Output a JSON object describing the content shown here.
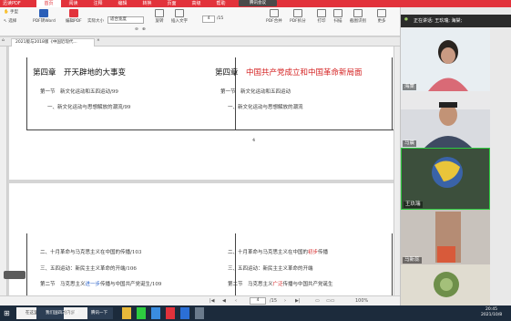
{
  "titlebar": {
    "app_name": "迅读PDF",
    "menus": [
      "首页",
      "阅读",
      "注释",
      "编辑",
      "转换",
      "页面",
      "高级",
      "帮助"
    ],
    "active_menu": "首页",
    "meeting_label": "腾讯会议"
  },
  "toolbar": {
    "hand": "手型",
    "select": "选择",
    "pdf_to_word": "PDF转Word",
    "edit_pdf": "编辑PDF",
    "actual_size": "实际大小",
    "zoom_value": "适合宽度",
    "rotate": "旋转",
    "insert_text": "插入文字",
    "page_current": "4",
    "page_total": "/15",
    "pdf_merge": "PDF合并",
    "pdf_split": "PDF拆分",
    "print": "打印",
    "ocr": "扫描",
    "screenshot": "截图识别",
    "more": "更多"
  },
  "tab": {
    "label": "2021版与2018版《中国近现代..."
  },
  "page1": {
    "left_chapter": "第四章　开天辟地的大事变",
    "left_section": "第一节　新文化运动和五四运动/99",
    "left_item": "一、新文化运动与思想解放的潮流/99",
    "right_chapter": "第四章",
    "right_chapter_red": "中国共产党成立和中国革命新局面",
    "right_section": "第一节　新文化运动和五四运动",
    "right_item": "一、新文化运动与思想解放的潮流",
    "page_number": "4"
  },
  "page2": {
    "left_rows": [
      "二、十月革命与马克思主义在中国的传播/103",
      "三、五四运动：新民主主义革命的开端/106",
      "第二节　马克思主义进一步传播与中国共产党诞生/109"
    ],
    "left_row3_pre": "第二节　马克思主义",
    "left_row3_blue": "进一步",
    "left_row3_post": "传播与中国共产党诞生/109",
    "right_row1_pre": "二、十月革命与马克思主义在中国的",
    "right_row1_red": "初步",
    "right_row1_post": "传播",
    "right_row2": "三、五四运动：新民主主义革命的开端",
    "right_row3_pre": "第二节　马克思主义",
    "right_row3_red": "广泛",
    "right_row3_post": "传播与中国共产党诞生"
  },
  "statusbar": {
    "page_current": "4",
    "page_total": "/15",
    "zoom": "100%"
  },
  "meeting": {
    "speaker": "正在讲话: 王玖瑞; 海棠;",
    "participants": [
      {
        "name": "海棠"
      },
      {
        "name": "马晨"
      },
      {
        "name": "王玖瑞"
      },
      {
        "name": "马新蕊"
      },
      {
        "name": ""
      }
    ]
  },
  "taskbar": {
    "search_placeholder": "在这里输入你要搜索的内容",
    "window_label": "我们国四三目的好...",
    "app_label": "腾讯一下",
    "time": "20:45",
    "date": "2021/10/8"
  },
  "colors": {
    "brand_red": "#e2323b",
    "chapter_red": "#d42020",
    "highlight_blue": "#2a62c9",
    "taskbar": "#1c2b3c"
  }
}
